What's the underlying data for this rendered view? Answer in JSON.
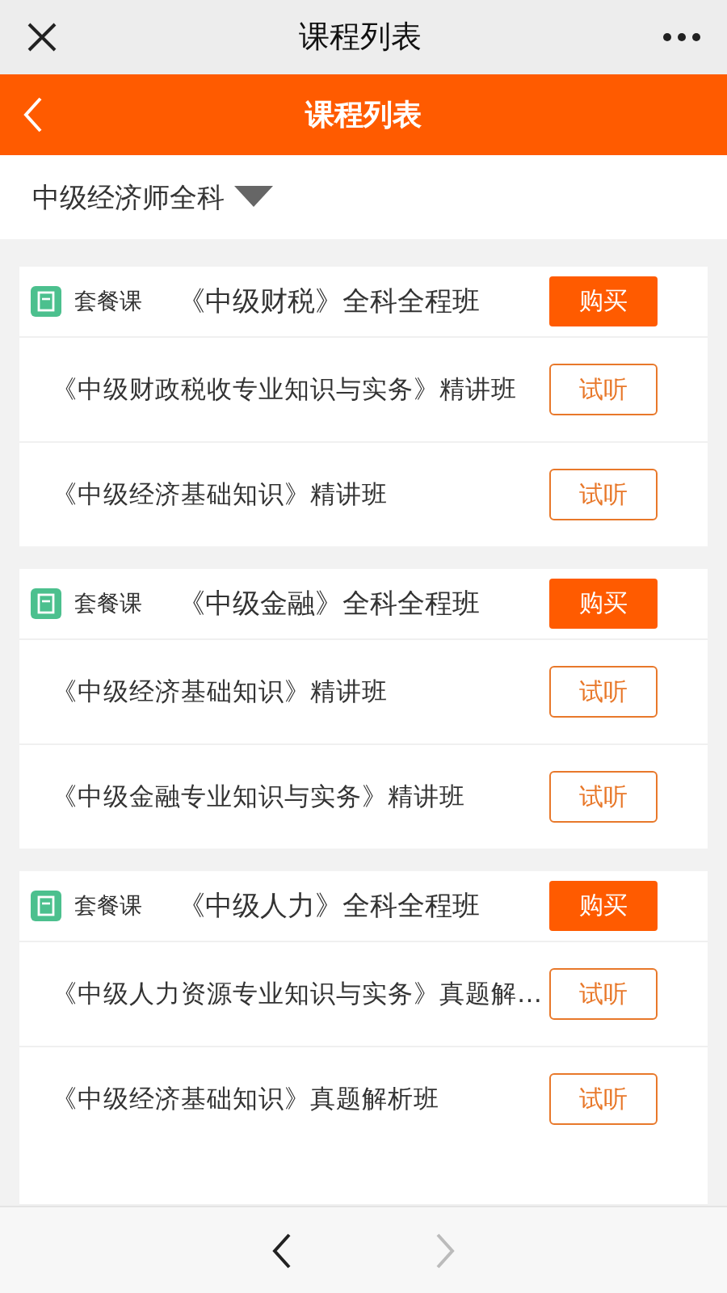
{
  "window": {
    "title": "课程列表"
  },
  "header": {
    "title": "课程列表"
  },
  "filter": {
    "label": "中级经济师全科"
  },
  "packages": [
    {
      "tag": "套餐课",
      "title": "《中级财税》全科全程班",
      "button": "购买",
      "courses": [
        {
          "title": "《中级财政税收专业知识与实务》精讲班",
          "button": "试听"
        },
        {
          "title": "《中级经济基础知识》精讲班",
          "button": "试听"
        }
      ]
    },
    {
      "tag": "套餐课",
      "title": "《中级金融》全科全程班",
      "button": "购买",
      "courses": [
        {
          "title": "《中级经济基础知识》精讲班",
          "button": "试听"
        },
        {
          "title": "《中级金融专业知识与实务》精讲班",
          "button": "试听"
        }
      ]
    },
    {
      "tag": "套餐课",
      "title": "《中级人力》全科全程班",
      "button": "购买",
      "courses": [
        {
          "title": "《中级人力资源专业知识与实务》真题解…",
          "button": "试听"
        },
        {
          "title": "《中级经济基础知识》真题解析班",
          "button": "试听"
        }
      ]
    }
  ],
  "bottom_nav": {
    "back": {
      "disabled": false
    },
    "forward": {
      "disabled": true
    }
  }
}
